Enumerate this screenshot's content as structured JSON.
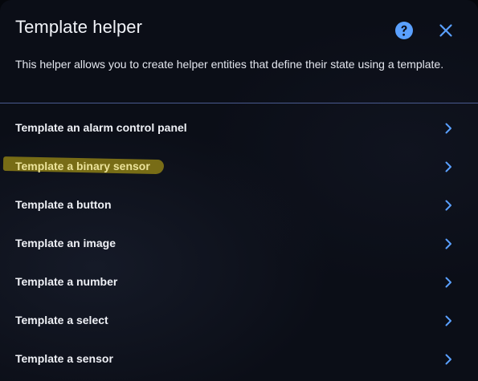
{
  "dialog": {
    "title": "Template helper",
    "description": "This helper allows you to create helper entities that define their state using a template.",
    "help_icon": "help-circle-icon",
    "close_icon": "close-icon"
  },
  "colors": {
    "accent": "#5aa0ff",
    "divider": "#4a5a8f",
    "highlight": "#968714"
  },
  "items": [
    {
      "label": "Template an alarm control panel",
      "highlighted": false
    },
    {
      "label": "Template a binary sensor",
      "highlighted": true
    },
    {
      "label": "Template a button",
      "highlighted": false
    },
    {
      "label": "Template an image",
      "highlighted": false
    },
    {
      "label": "Template a number",
      "highlighted": false
    },
    {
      "label": "Template a select",
      "highlighted": false
    },
    {
      "label": "Template a sensor",
      "highlighted": false
    }
  ]
}
